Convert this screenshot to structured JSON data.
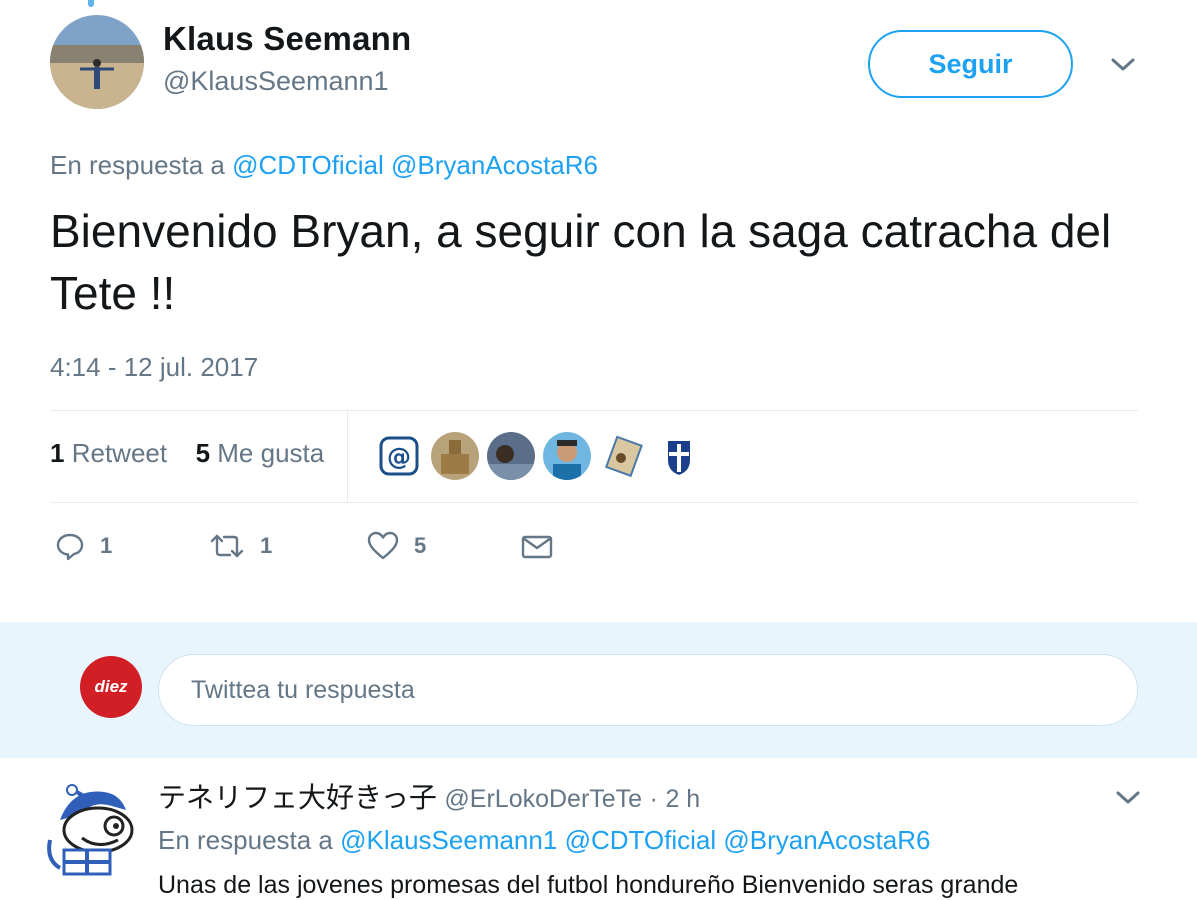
{
  "colors": {
    "accent": "#1da1f2",
    "text_secondary": "#657786",
    "text_primary": "#14171a",
    "composer_bg": "#e8f5fd",
    "brand_red": "#d21f26"
  },
  "tweet": {
    "author": {
      "name": "Klaus Seemann",
      "handle": "@KlausSeemann1",
      "avatar_icon": "profile-photo"
    },
    "follow_label": "Seguir",
    "menu_icon": "chevron-down-icon",
    "reply_prefix": "En respuesta a",
    "reply_mentions": [
      "@CDTOficial",
      "@BryanAcostaR6"
    ],
    "text": "Bienvenido Bryan, a seguir con la saga catracha del Tete !!",
    "timestamp": "4:14 - 12 jul. 2017",
    "stats": {
      "retweets_count": "1",
      "retweets_label": "Retweet",
      "likes_count": "5",
      "likes_label": "Me gusta"
    },
    "liker_icons": [
      "at-sign-icon",
      "liker-avatar",
      "liker-avatar",
      "liker-avatar",
      "liker-avatar",
      "team-crest-icon"
    ],
    "actions": {
      "reply_count": "1",
      "retweet_count": "1",
      "like_count": "5"
    }
  },
  "composer": {
    "avatar_text": "diez",
    "placeholder": "Twittea tu respuesta"
  },
  "reply2": {
    "name": "テネリフェ大好きっ子",
    "handle": "@ErLokoDerTeTe",
    "separator": "·",
    "time": "2 h",
    "reply_prefix": "En respuesta a",
    "reply_mentions": [
      "@KlausSeemann1",
      "@CDTOficial",
      "@BryanAcostaR6"
    ],
    "text": "Unas de las jovenes promesas del futbol hondureño Bienvenido seras grande"
  }
}
